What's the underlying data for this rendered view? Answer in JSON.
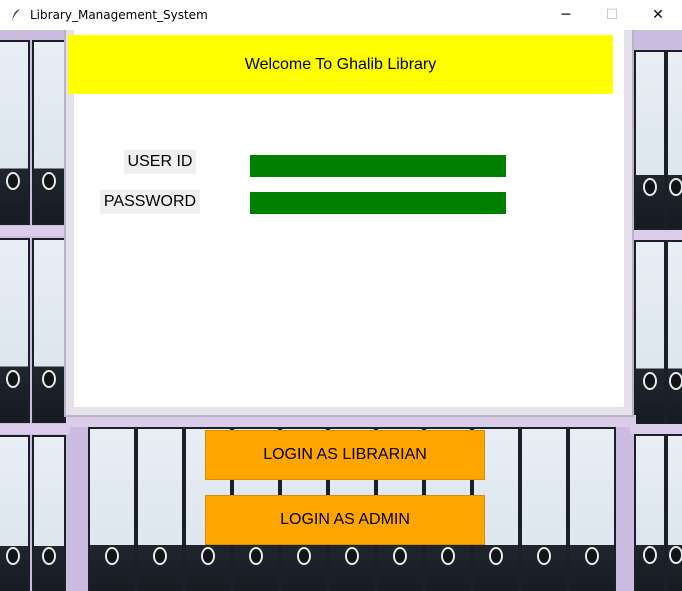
{
  "window": {
    "title": "Library_Management_System",
    "minimize_label": "─",
    "maximize_label": "☐",
    "close_label": "✕"
  },
  "header": {
    "welcome_text": "Welcome To Ghalib Library"
  },
  "form": {
    "user_id_label": "USER ID",
    "password_label": "PASSWORD",
    "user_id_value": "",
    "password_value": "",
    "field_color": "#008000"
  },
  "actions": {
    "librarian_label": "LOGIN AS LIBRARIAN",
    "admin_label": "LOGIN AS ADMIN",
    "button_color": "#ffa500"
  },
  "theme": {
    "header_color": "#ffff00",
    "background_image": "office-binders-shelf"
  }
}
